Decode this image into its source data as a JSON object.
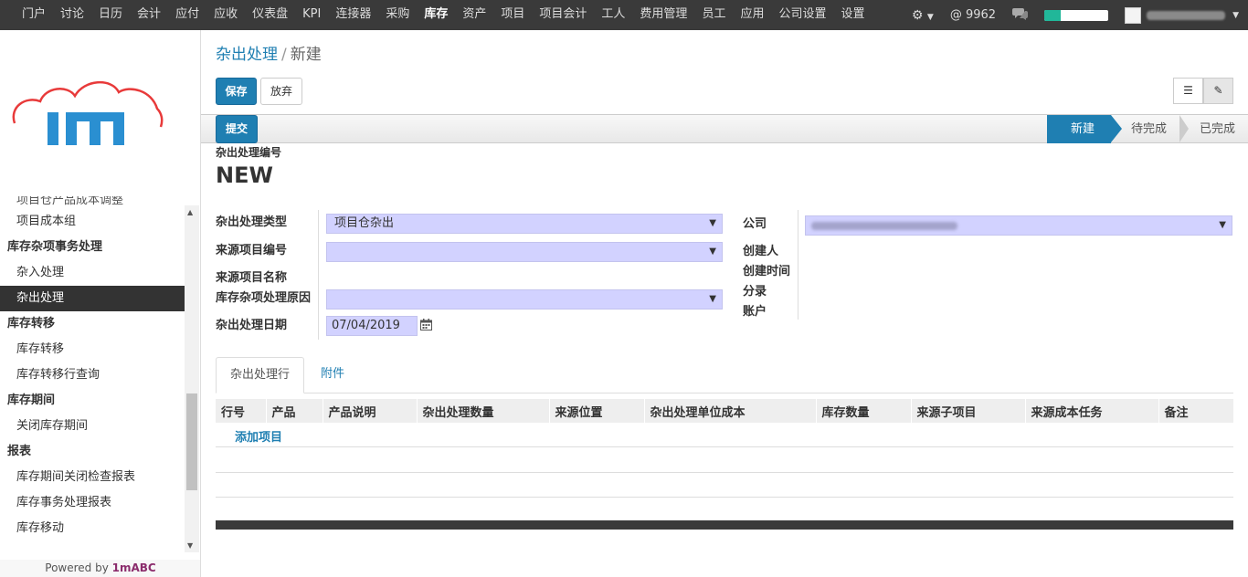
{
  "topbar": {
    "menu": [
      "门户",
      "讨论",
      "日历",
      "会计",
      "应付",
      "应收",
      "仪表盘",
      "KPI",
      "连接器",
      "采购",
      "库存",
      "资产",
      "项目",
      "项目会计",
      "工人",
      "费用管理",
      "员工",
      "应用",
      "公司设置",
      "设置"
    ],
    "active_menu": "库存",
    "message_count": "9962",
    "progress_fraction": 0.25,
    "progress_color": "#21b799"
  },
  "sidebar": {
    "partial_top_item": "项目仓产品成本调整",
    "items_before": [
      "项目成本组"
    ],
    "sections": [
      {
        "heading": "库存杂项事务处理",
        "items": [
          "杂入处理",
          "杂出处理"
        ]
      },
      {
        "heading": "库存转移",
        "items": [
          "库存转移",
          "库存转移行查询"
        ]
      },
      {
        "heading": "库存期间",
        "items": [
          "关闭库存期间"
        ]
      },
      {
        "heading": "报表",
        "items": [
          "库存期间关闭检查报表",
          "库存事务处理报表",
          "库存移动"
        ]
      }
    ],
    "active_item": "杂出处理",
    "powered_by_prefix": "Powered by ",
    "powered_by_brand": "1mABC"
  },
  "breadcrumb": {
    "parent": "杂出处理",
    "separator": "/",
    "current": "新建"
  },
  "buttons": {
    "save": "保存",
    "discard": "放弃",
    "submit": "提交"
  },
  "statusbar": {
    "stages": [
      "新建",
      "待完成",
      "已完成"
    ],
    "active": "新建"
  },
  "form": {
    "number_label": "杂出处理编号",
    "number_value": "NEW",
    "fields_left": [
      {
        "label": "杂出处理类型",
        "value": "项目仓杂出"
      },
      {
        "label": "来源项目编号",
        "value": ""
      },
      {
        "label": "来源项目名称",
        "value": ""
      },
      {
        "label": "库存杂项处理原因",
        "value": ""
      },
      {
        "label": "杂出处理日期",
        "value": "07/04/2019"
      }
    ],
    "fields_right": [
      {
        "label": "公司",
        "value": "上海XX信息技术有限公司"
      },
      {
        "label": "创建人",
        "value": ""
      },
      {
        "label": "创建时间",
        "value": ""
      },
      {
        "label": "分录",
        "value": ""
      },
      {
        "label": "账户",
        "value": ""
      }
    ]
  },
  "tabs": [
    "杂出处理行",
    "附件"
  ],
  "grid": {
    "columns": [
      "行号",
      "产品",
      "产品说明",
      "杂出处理数量",
      "来源位置",
      "杂出处理单位成本",
      "库存数量",
      "来源子项目",
      "来源成本任务",
      "备注"
    ],
    "add_item": "添加项目"
  }
}
